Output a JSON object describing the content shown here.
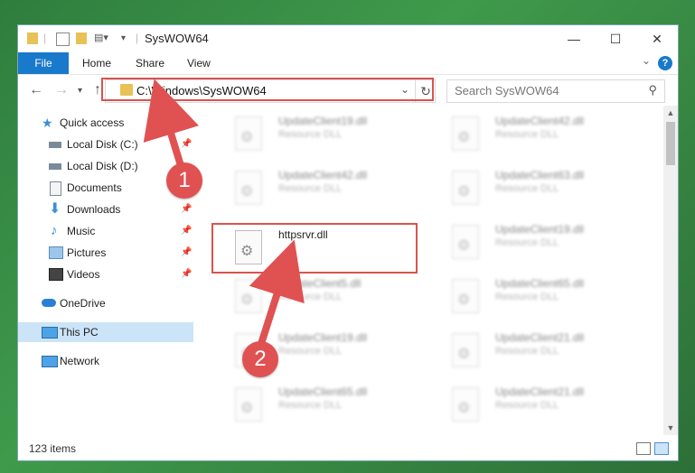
{
  "window": {
    "title": "SysWOW64",
    "controls": {
      "minimize": "—",
      "maximize": "☐",
      "close": "✕"
    }
  },
  "ribbon": {
    "tabs": [
      "File",
      "Home",
      "Share",
      "View"
    ],
    "help": "?"
  },
  "address": {
    "path": "C:\\Windows\\SysWOW64",
    "search_placeholder": "Search SysWOW64"
  },
  "sidebar": {
    "items": [
      {
        "label": "Quick access",
        "icon": "star-icon",
        "pinned": false
      },
      {
        "label": "Local Disk (C:)",
        "icon": "drive-icon",
        "pinned": true
      },
      {
        "label": "Local Disk (D:)",
        "icon": "drive-icon",
        "pinned": false
      },
      {
        "label": "Documents",
        "icon": "documents-icon",
        "pinned": false
      },
      {
        "label": "Downloads",
        "icon": "download-arrow-icon",
        "pinned": true
      },
      {
        "label": "Music",
        "icon": "music-note-icon",
        "pinned": true
      },
      {
        "label": "Pictures",
        "icon": "pictures-icon",
        "pinned": true
      },
      {
        "label": "Videos",
        "icon": "film-icon",
        "pinned": true
      },
      {
        "label": "OneDrive",
        "icon": "cloud-icon",
        "pinned": false
      },
      {
        "label": "This PC",
        "icon": "computer-icon",
        "pinned": false,
        "selected": true
      },
      {
        "label": "Network",
        "icon": "network-icon",
        "pinned": false
      }
    ]
  },
  "files": {
    "highlighted": {
      "name": "httpsrvr.dll"
    },
    "left_column": [
      {
        "name": "UpdateClient19.dll",
        "desc": "Resource DLL"
      },
      {
        "name": "UpdateClient42.dll",
        "desc": "Resource DLL"
      },
      {
        "name": "UpdateClient5.dll",
        "desc": "Resource DLL"
      },
      {
        "name": "UpdateClient19.dll",
        "desc": "Resource DLL"
      },
      {
        "name": "UpdateClient65.dll",
        "desc": "Resource DLL"
      }
    ],
    "right_column": [
      {
        "name": "UpdateClient42.dll",
        "desc": "Resource DLL"
      },
      {
        "name": "UpdateClient63.dll",
        "desc": "Resource DLL"
      },
      {
        "name": "UpdateClient19.dll",
        "desc": "Resource DLL"
      },
      {
        "name": "UpdateClient65.dll",
        "desc": "Resource DLL"
      },
      {
        "name": "UpdateClient21.dll",
        "desc": "Resource DLL"
      },
      {
        "name": "UpdateClient21.dll",
        "desc": "Resource DLL"
      }
    ]
  },
  "status": {
    "item_count": "123 items"
  },
  "callouts": {
    "one": "1",
    "two": "2"
  },
  "colors": {
    "accent": "#1979ca",
    "highlight": "#d9534f",
    "selected": "#cce4f7"
  }
}
